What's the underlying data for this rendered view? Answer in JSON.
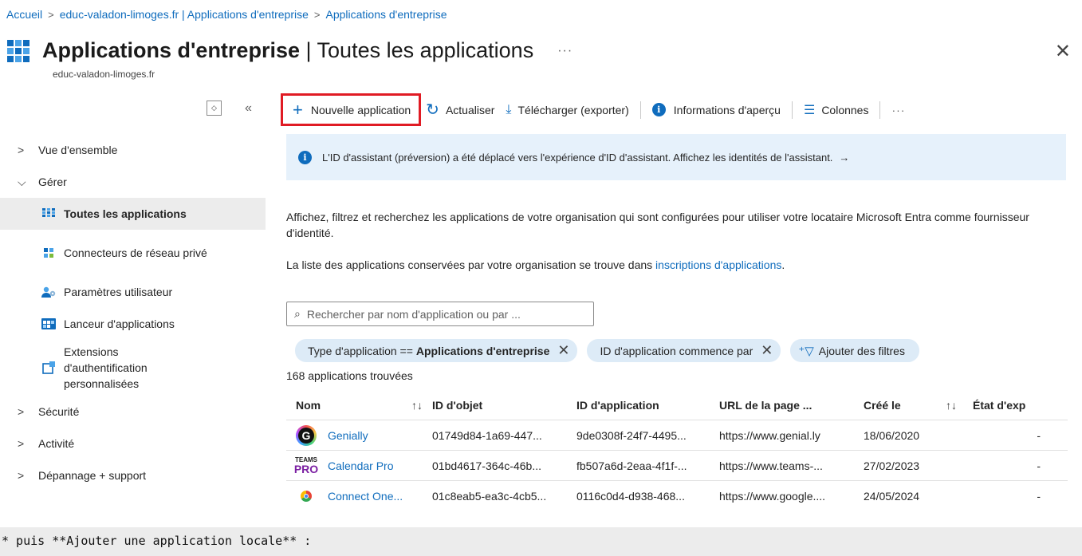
{
  "breadcrumb": [
    "Accueil",
    "educ-valadon-limoges.fr | Applications d'entreprise",
    "Applications d'entreprise"
  ],
  "header": {
    "title_bold": "Applications d'entreprise",
    "title_sep": " | ",
    "title_rest": "Toutes les applications",
    "more": "···",
    "subtitle": "educ-valadon-limoges.fr",
    "close": "✕"
  },
  "sidebar": {
    "collapse_icon": "«",
    "items": [
      {
        "label": "Vue d'ensemble",
        "chevron": "›"
      },
      {
        "label": "Gérer",
        "chevron": "⌄"
      }
    ],
    "sub_items": [
      {
        "label": "Toutes les applications",
        "icon": "app-grid-icon"
      },
      {
        "label": "Connecteurs de réseau privé",
        "icon": "network-connector-icon"
      },
      {
        "label": "Paramètres utilisateur",
        "icon": "user-settings-icon"
      },
      {
        "label": "Lanceur d'applications",
        "icon": "app-launcher-icon"
      },
      {
        "label": "Extensions d'authentification personnalisées",
        "icon": "auth-extension-icon"
      }
    ],
    "bottom_items": [
      {
        "label": "Sécurité",
        "chevron": "›"
      },
      {
        "label": "Activité",
        "chevron": "›"
      },
      {
        "label": "Dépannage + support",
        "chevron": "›"
      }
    ]
  },
  "toolbar": {
    "new_app": "Nouvelle application",
    "refresh": "Actualiser",
    "download": "Télécharger (exporter)",
    "preview_info": "Informations d'aperçu",
    "columns": "Colonnes",
    "more": "···"
  },
  "banner": {
    "text": "L'ID d'assistant (préversion) a été déplacé vers l'expérience d'ID d'assistant. Affichez les identités de l'assistant.",
    "arrow": "→"
  },
  "description": {
    "line1": "Affichez, filtrez et recherchez les applications de votre organisation qui sont configurées pour utiliser votre locataire Microsoft Entra comme fournisseur d'identité.",
    "line2_prefix": "La liste des applications conservées par votre organisation se trouve dans ",
    "line2_link": "inscriptions d'applications",
    "line2_suffix": "."
  },
  "search": {
    "placeholder": "Rechercher par nom d'application ou par ..."
  },
  "filters": [
    {
      "prefix": "Type d'application == ",
      "value": "Applications d'entreprise"
    },
    {
      "prefix": "ID d'application commence par",
      "value": ""
    }
  ],
  "add_filter": "Ajouter des filtres",
  "result_count": "168 applications trouvées",
  "table": {
    "headers": [
      "Nom",
      "ID d'objet",
      "ID d'application",
      "URL de la page ...",
      "Créé le",
      "État d'exp"
    ],
    "rows": [
      {
        "name": "Genially",
        "object_id": "01749d84-1a69-447...",
        "app_id": "9de0308f-24f7-4495...",
        "url": "https://www.genial.ly",
        "created": "18/06/2020",
        "state": "-",
        "logo": "genially-logo"
      },
      {
        "name": "Calendar Pro",
        "object_id": "01bd4617-364c-46b...",
        "app_id": "fb507a6d-2eaa-4f1f-...",
        "url": "https://www.teams-...",
        "created": "27/02/2023",
        "state": "-",
        "logo": "teams-pro-logo",
        "logo_text": [
          "TEAMS",
          "PRO"
        ]
      },
      {
        "name": "Connect One...",
        "object_id": "01c8eab5-ea3c-4cb5...",
        "app_id": "0116c0d4-d938-468...",
        "url": "https://www.google....",
        "created": "24/05/2024",
        "state": "-",
        "logo": "chrome-logo"
      }
    ]
  },
  "footer_text": "* puis **Ajouter une application locale** :",
  "colors": {
    "accent": "#0f6cbd",
    "highlight_border": "#e01b24",
    "banner_bg": "#e6f1fb",
    "pill_bg": "#ddebf7"
  }
}
